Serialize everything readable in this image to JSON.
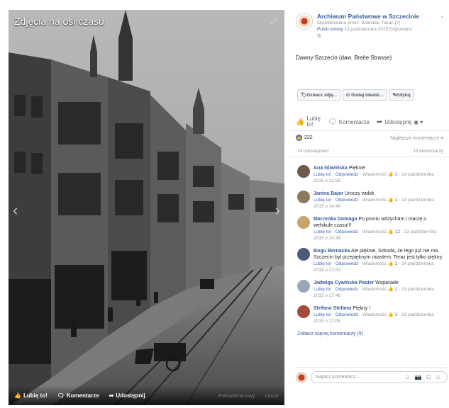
{
  "viewer": {
    "album_title": "Zdjęcia na osi czasu",
    "bar": {
      "like": "Lubię to!",
      "comment": "Komentarze",
      "share": "Udostępnij",
      "muted_1": "Pełnoekranowy",
      "muted_2": "Opcje"
    }
  },
  "post": {
    "page_name": "Archiwum Państwowe w Szczecinie",
    "published_by": "Opublikowane przez: Bolesław Tukan [?]",
    "like_page": "Polub stronę",
    "date": "13 października 2015",
    "edited": "Edytowano",
    "caption": "Dawny Szczecin (daw. Breite Strasse)",
    "buttons": [
      "Oznacz zdję...",
      "Dodaj lokaliz...",
      "Edytuj"
    ],
    "actions": {
      "like_line1": "Lubię",
      "like_line2": "to!",
      "comment": "Komentarze",
      "share": "Udostępnij"
    },
    "reaction_count": "222",
    "sort_label": "Najlepsze komentarze",
    "shares": "74 udostępnień",
    "comments_count": "15 komentarzy",
    "more_comments": "Zobacz więcej komentarzy (9)",
    "composer_placeholder": "Napisz komentarz..."
  },
  "comments": [
    {
      "author": "Ana Gliwińska",
      "text": "Pięknie",
      "meta": {
        "like": "Lubię to!",
        "reply": "Odpowiedz",
        "message": "Wiadomość",
        "likes": "1",
        "date": "14 października 2015 o 12:59"
      },
      "avatar_color": "#6e5a4a"
    },
    {
      "author": "Janina Bajor",
      "text": "Uroczy widok",
      "meta": {
        "like": "Lubię to!",
        "reply": "Odpowiedz",
        "message": "Wiadomość",
        "likes": "1",
        "date": "13 października 2015 o 14:48"
      },
      "avatar_color": "#8a7b5e"
    },
    {
      "author": "Marzenka Domaga",
      "text": "Po prostu wdzycham i marzę o wehikule czasu!!!",
      "meta": {
        "like": "Lubię to!",
        "reply": "Odpowiedz",
        "message": "Wiadomość",
        "likes": "12",
        "date": "13 października 2015 o 10:34"
      },
      "avatar_color": "#c8a36c"
    },
    {
      "author": "Bogu Bernacka",
      "text": "Ale pięknie. Szkoda, że tego już nie ma. Szczecin był przepięknym miastem. Teraz jest tylko piękny.",
      "meta": {
        "like": "Lubię to!",
        "reply": "Odpowiedz",
        "message": "Wiadomość",
        "likes": "1",
        "date": "14 października 2015 o 21:00"
      },
      "avatar_color": "#4c5a7a"
    },
    {
      "author": "Jadwiga Cywińska Paster",
      "text": "Wspaniale",
      "meta": {
        "like": "Lubię to!",
        "reply": "Odpowiedz",
        "message": "Wiadomość",
        "likes": "1",
        "date": "13 października 2015 o 17:46"
      },
      "avatar_color": "#9aa7b6"
    },
    {
      "author": "Stefano Stefano",
      "text": "Piękny !",
      "meta": {
        "like": "Lubię to!",
        "reply": "Odpowiedz",
        "message": "Wiadomość",
        "likes": "1",
        "date": "13 października 2015 o 17:05"
      },
      "avatar_color": "#a24a3c"
    }
  ]
}
